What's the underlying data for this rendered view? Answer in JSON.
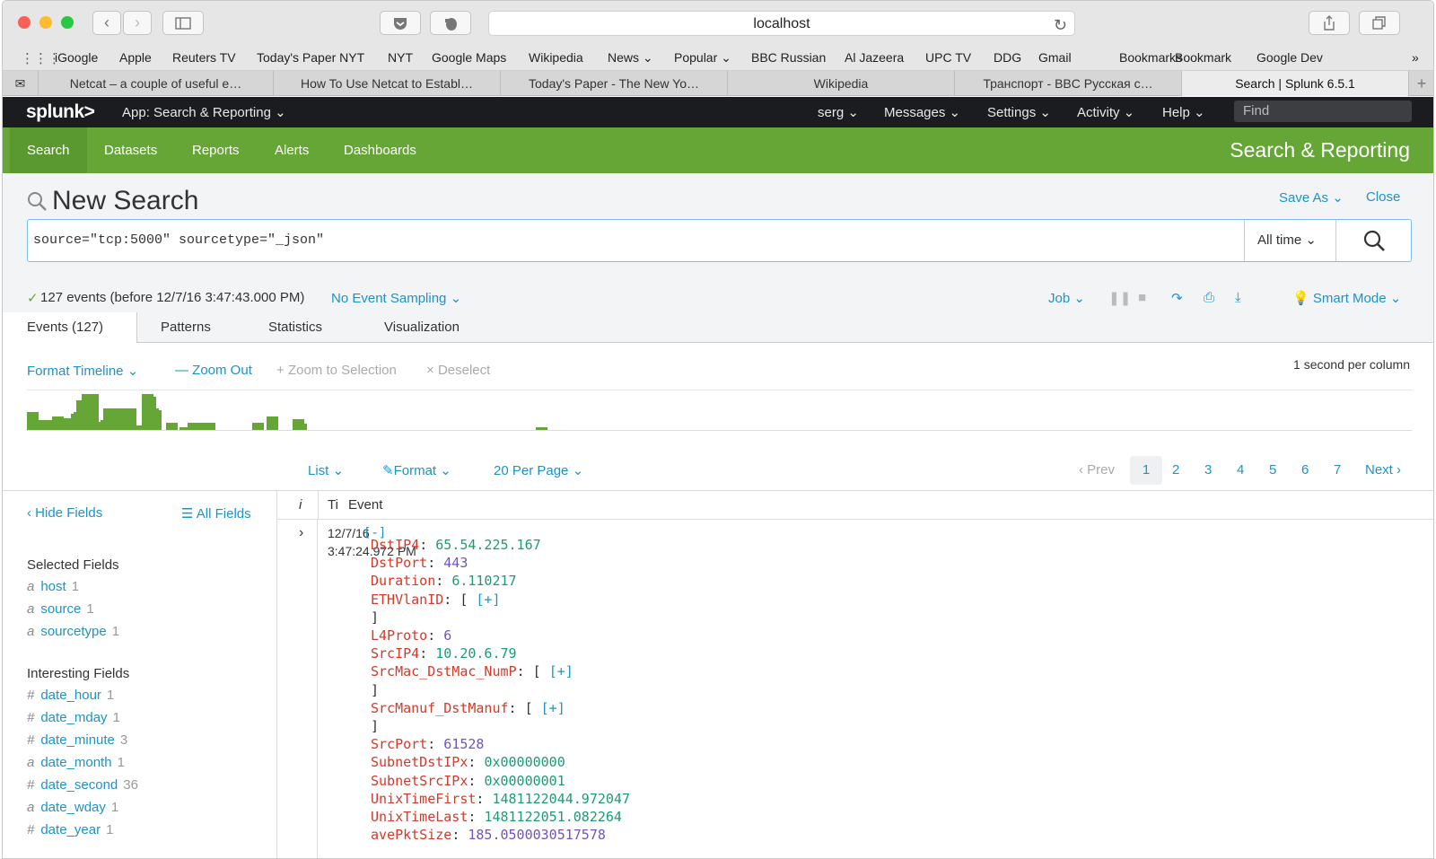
{
  "browser": {
    "url": "localhost",
    "bookmarks": [
      "iGoogle",
      "Apple",
      "Reuters TV",
      "Today's Paper NYT",
      "NYT",
      "Google Maps",
      "Wikipedia",
      "News",
      "Popular",
      "BBC Russian",
      "Al Jazeera",
      "UPC TV",
      "DDG",
      "Gmail",
      "Bookmarks",
      "Bookmark",
      "Google Dev"
    ],
    "tabs": [
      "Netcat – a couple of useful e…",
      "How To Use Netcat to Establ…",
      "Today's Paper - The New Yo…",
      "Wikipedia",
      "Транспорт - BBC Русская с…",
      "Search | Splunk 6.5.1"
    ],
    "active_tab": 5
  },
  "splunk_bar": {
    "logo": "splunk>",
    "app": "App: Search & Reporting",
    "user": "serg",
    "messages": "Messages",
    "settings": "Settings",
    "activity": "Activity",
    "help": "Help",
    "find_placeholder": "Find"
  },
  "app_nav": {
    "items": [
      "Search",
      "Datasets",
      "Reports",
      "Alerts",
      "Dashboards"
    ],
    "title": "Search & Reporting"
  },
  "search": {
    "title": "New Search",
    "save_as": "Save As",
    "close": "Close",
    "query": "source=\"tcp:5000\" sourcetype=\"_json\"",
    "time_range": "All time",
    "status": "127 events (before 12/7/16 3:47:43.000 PM)",
    "sampling": "No Event Sampling",
    "job": "Job",
    "mode": "Smart Mode"
  },
  "view_tabs": [
    "Events (127)",
    "Patterns",
    "Statistics",
    "Visualization"
  ],
  "timeline": {
    "format": "Format Timeline",
    "zoom_out": "Zoom Out",
    "zoom_sel": "Zoom to Selection",
    "deselect": "Deselect",
    "scale": "1 second per column",
    "bars": [
      [
        0.28,
        0.45
      ],
      [
        0.31,
        0.25
      ],
      [
        0.34,
        0.25
      ],
      [
        0.37,
        0.25
      ],
      [
        0.4,
        0.25
      ],
      [
        0.43,
        0.25
      ],
      [
        0.46,
        0.25
      ],
      [
        0.53,
        0.12
      ],
      [
        0.56,
        0.35
      ],
      [
        0.65,
        0.3
      ],
      [
        0.68,
        0.3
      ],
      [
        0.71,
        0.3
      ],
      [
        0.74,
        0.3
      ],
      [
        0.77,
        0.4
      ],
      [
        0.8,
        0.45
      ],
      [
        0.83,
        0.75
      ],
      [
        0.86,
        0.25
      ],
      [
        0.89,
        0.9
      ],
      [
        0.92,
        0.4
      ],
      [
        0.95,
        0.9
      ],
      [
        1.07,
        0.2
      ],
      [
        1.1,
        0.25
      ],
      [
        1.13,
        0.55
      ],
      [
        1.16,
        0.12
      ],
      [
        1.19,
        0.12
      ],
      [
        1.22,
        0.2
      ],
      [
        1.25,
        0.55
      ],
      [
        1.28,
        0.12
      ],
      [
        1.31,
        0.12
      ],
      [
        1.34,
        0.12
      ],
      [
        1.37,
        0.55
      ],
      [
        1.4,
        0.12
      ],
      [
        1.43,
        0.12
      ],
      [
        1.46,
        0.12
      ],
      [
        1.56,
        0.9
      ],
      [
        1.59,
        0.85
      ],
      [
        1.62,
        0.55
      ],
      [
        1.65,
        0.5
      ],
      [
        1.83,
        0.18
      ],
      [
        1.98,
        0.06
      ],
      [
        2.01,
        0.06
      ],
      [
        2.04,
        0.06
      ],
      [
        2.07,
        0.18
      ],
      [
        2.1,
        0.18
      ],
      [
        2.13,
        0.18
      ],
      [
        2.16,
        0.18
      ],
      [
        2.19,
        0.18
      ],
      [
        2.22,
        0.18
      ],
      [
        2.25,
        0.18
      ],
      [
        2.79,
        0.18
      ],
      [
        2.95,
        0.35
      ],
      [
        3.24,
        0.28
      ],
      [
        3.27,
        0.15
      ],
      [
        5.95,
        0.06
      ]
    ]
  },
  "results_bar": {
    "list": "List",
    "format": "Format",
    "per_page": "20 Per Page",
    "prev": "Prev",
    "pages": [
      "1",
      "2",
      "3",
      "4",
      "5",
      "6",
      "7"
    ],
    "next": "Next"
  },
  "fields": {
    "hide": "Hide Fields",
    "all": "All Fields",
    "selected_title": "Selected Fields",
    "selected": [
      {
        "type": "a",
        "name": "host",
        "count": "1"
      },
      {
        "type": "a",
        "name": "source",
        "count": "1"
      },
      {
        "type": "a",
        "name": "sourcetype",
        "count": "1"
      }
    ],
    "interesting_title": "Interesting Fields",
    "interesting": [
      {
        "type": "#",
        "name": "date_hour",
        "count": "1"
      },
      {
        "type": "#",
        "name": "date_mday",
        "count": "1"
      },
      {
        "type": "#",
        "name": "date_minute",
        "count": "3"
      },
      {
        "type": "a",
        "name": "date_month",
        "count": "1"
      },
      {
        "type": "#",
        "name": "date_second",
        "count": "36"
      },
      {
        "type": "a",
        "name": "date_wday",
        "count": "1"
      },
      {
        "type": "#",
        "name": "date_year",
        "count": "1"
      }
    ]
  },
  "events": {
    "col_i": "i",
    "col_time": "Ti",
    "col_event": "Event",
    "time_line1": "12/7/16",
    "time_line2": "3:47:24.972 PM",
    "open": "[-]",
    "lines": [
      {
        "k": "DstIP4",
        "v": "65.54.225.167",
        "t": "s"
      },
      {
        "k": "DstPort",
        "v": "443",
        "t": "n"
      },
      {
        "k": "Duration",
        "v": "6.110217",
        "t": "s"
      },
      {
        "k": "ETHVlanID",
        "v": "[ [+]",
        "t": "o"
      },
      {
        "k": "",
        "v": "]",
        "t": "c"
      },
      {
        "k": "L4Proto",
        "v": "6",
        "t": "n"
      },
      {
        "k": "SrcIP4",
        "v": "10.20.6.79",
        "t": "s"
      },
      {
        "k": "SrcMac_DstMac_NumP",
        "v": "[ [+]",
        "t": "o"
      },
      {
        "k": "",
        "v": "]",
        "t": "c"
      },
      {
        "k": "SrcManuf_DstManuf",
        "v": "[ [+]",
        "t": "o"
      },
      {
        "k": "",
        "v": "]",
        "t": "c"
      },
      {
        "k": "SrcPort",
        "v": "61528",
        "t": "n"
      },
      {
        "k": "SubnetDstIPx",
        "v": "0x00000000",
        "t": "s"
      },
      {
        "k": "SubnetSrcIPx",
        "v": "0x00000001",
        "t": "s"
      },
      {
        "k": "UnixTimeFirst",
        "v": "1481122044.972047",
        "t": "s"
      },
      {
        "k": "UnixTimeLast",
        "v": "1481122051.082264",
        "t": "s"
      },
      {
        "k": "avePktSize",
        "v": "185.0500030517578",
        "t": "n"
      }
    ]
  },
  "colors": {
    "splunk_green": "#65a637",
    "link": "#1e93c6",
    "dark_bar": "#1a1c20",
    "json_key": "#d23a2a",
    "json_str": "#1a9d6f",
    "json_num": "#6e55b7"
  }
}
